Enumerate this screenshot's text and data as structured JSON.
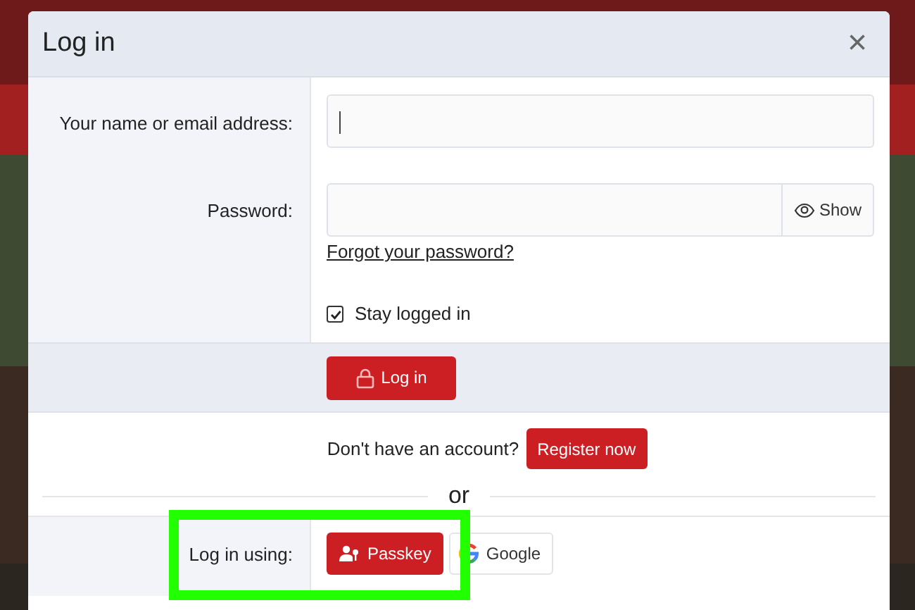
{
  "dialog": {
    "title": "Log in",
    "close": "×"
  },
  "fields": [
    {
      "kind": "text",
      "label": "Your name or email address:",
      "focused": true
    },
    {
      "kind": "password",
      "label": "Password:",
      "show_button": "Show",
      "link": "Forgot your password?"
    }
  ],
  "stay_logged_in": {
    "label": "Stay logged in",
    "checked": true
  },
  "submit": "Log in",
  "register": {
    "text": "Don't have an account?",
    "button": "Register now"
  },
  "divider": "or",
  "external": {
    "label": "Log in using:",
    "providers": [
      {
        "kind": "passkey",
        "label": "Passkey"
      },
      {
        "kind": "google",
        "label": "Google"
      }
    ]
  },
  "highlight": true
}
